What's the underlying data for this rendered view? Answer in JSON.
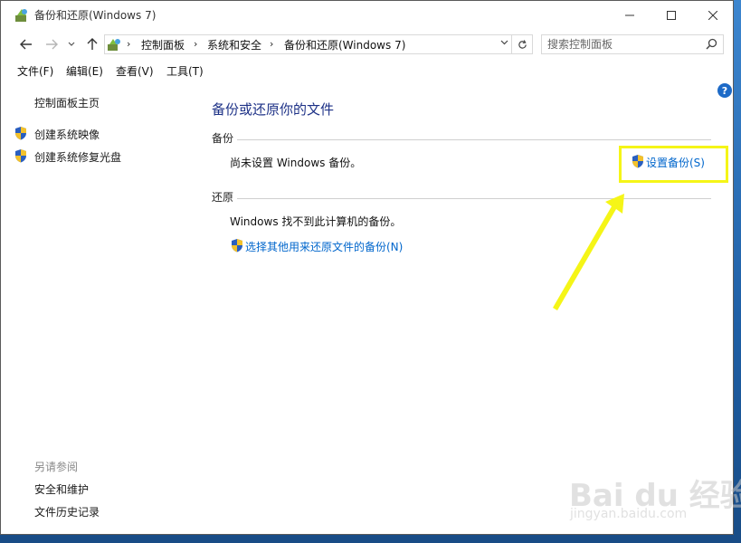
{
  "window": {
    "title": "备份和还原(Windows 7)"
  },
  "address": {
    "crumbs": [
      "控制面板",
      "系统和安全",
      "备份和还原(Windows 7)"
    ]
  },
  "search": {
    "placeholder": "搜索控制面板"
  },
  "menu": {
    "items": [
      "文件(F)",
      "编辑(E)",
      "查看(V)",
      "工具(T)"
    ]
  },
  "left_pane": {
    "home": "控制面板主页",
    "links": [
      "创建系统映像",
      "创建系统修复光盘"
    ],
    "see_also_title": "另请参阅",
    "see_also": [
      "安全和维护",
      "文件历史记录"
    ]
  },
  "main": {
    "title": "备份或还原你的文件",
    "backup": {
      "label": "备份",
      "status": "尚未设置 Windows 备份。",
      "setup_link": "设置备份(S)"
    },
    "restore": {
      "label": "还原",
      "status": "Windows 找不到此计算机的备份。",
      "other_link": "选择其他用来还原文件的备份(N)"
    }
  },
  "help": {
    "glyph": "?"
  },
  "watermark": {
    "main": "Bai du 经验",
    "sub": "jingyan.baidu.com"
  },
  "colors": {
    "link": "#0066cc",
    "title": "#1e3287",
    "highlight": "#f5f517"
  }
}
